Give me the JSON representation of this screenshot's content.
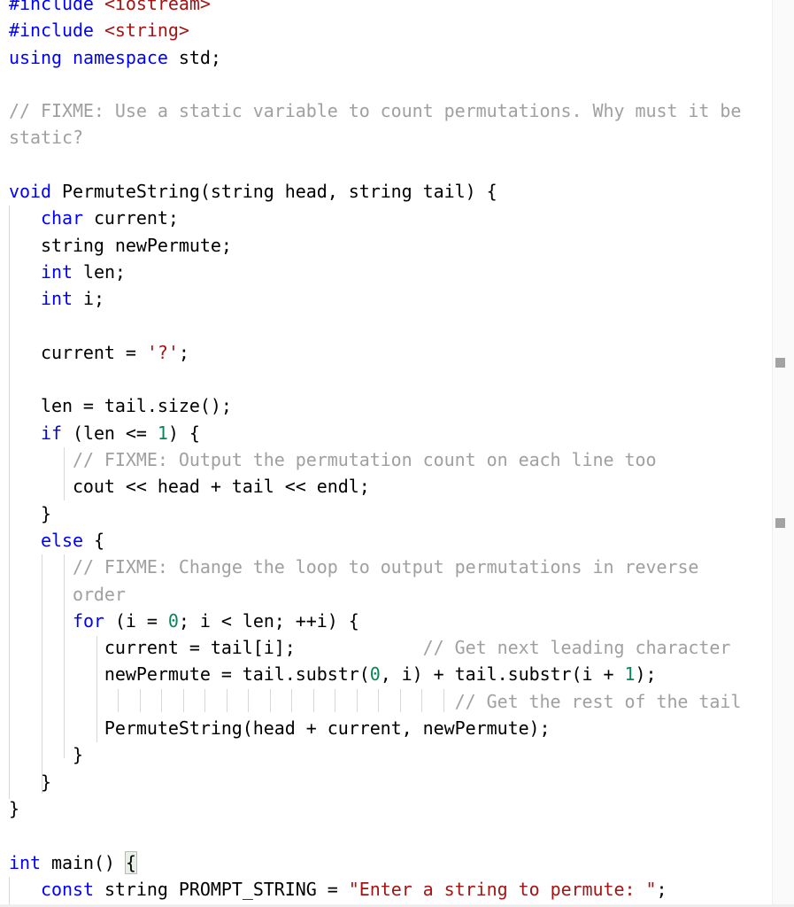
{
  "editor": {
    "language": "cpp",
    "lines": [
      [
        {
          "t": "#include",
          "c": "kw"
        },
        {
          "t": " "
        },
        {
          "t": "<iostream>",
          "c": "str"
        }
      ],
      [
        {
          "t": "#include",
          "c": "kw"
        },
        {
          "t": " "
        },
        {
          "t": "<string>",
          "c": "str"
        }
      ],
      [
        {
          "t": "using",
          "c": "kw"
        },
        {
          "t": " "
        },
        {
          "t": "namespace",
          "c": "kw"
        },
        {
          "t": " std;"
        }
      ],
      [],
      [
        {
          "t": "// FIXME: Use a static variable to count permutations. Why must it be",
          "c": "cm"
        }
      ],
      [
        {
          "t": "static?",
          "c": "cm"
        }
      ],
      [],
      [
        {
          "t": "void",
          "c": "kw"
        },
        {
          "t": " PermuteString(string head, string tail) {"
        }
      ],
      [
        {
          "t": "   "
        },
        {
          "t": "char",
          "c": "kw"
        },
        {
          "t": " current;"
        }
      ],
      [
        {
          "t": "   string newPermute;"
        }
      ],
      [
        {
          "t": "   "
        },
        {
          "t": "int",
          "c": "kw"
        },
        {
          "t": " len;"
        }
      ],
      [
        {
          "t": "   "
        },
        {
          "t": "int",
          "c": "kw"
        },
        {
          "t": " i;"
        }
      ],
      [],
      [
        {
          "t": "   current = "
        },
        {
          "t": "'?'",
          "c": "str"
        },
        {
          "t": ";"
        }
      ],
      [],
      [
        {
          "t": "   len = tail.size();"
        }
      ],
      [
        {
          "t": "   "
        },
        {
          "t": "if",
          "c": "kw"
        },
        {
          "t": " (len <= "
        },
        {
          "t": "1",
          "c": "num"
        },
        {
          "t": ") {"
        }
      ],
      [
        {
          "t": "      "
        },
        {
          "t": "// FIXME: Output the permutation count on each line too",
          "c": "cm"
        }
      ],
      [
        {
          "t": "      cout << head + tail << endl;"
        }
      ],
      [
        {
          "t": "   }"
        }
      ],
      [
        {
          "t": "   "
        },
        {
          "t": "else",
          "c": "kw"
        },
        {
          "t": " {"
        }
      ],
      [
        {
          "t": "      "
        },
        {
          "t": "// FIXME: Change the loop to output permutations in reverse",
          "c": "cm"
        }
      ],
      [
        {
          "t": "      "
        },
        {
          "t": "order",
          "c": "cm"
        }
      ],
      [
        {
          "t": "      "
        },
        {
          "t": "for",
          "c": "kw"
        },
        {
          "t": " (i = "
        },
        {
          "t": "0",
          "c": "num"
        },
        {
          "t": "; i < len; ++i) {"
        }
      ],
      [
        {
          "t": "         current = tail[i];            "
        },
        {
          "t": "// Get next leading character",
          "c": "cm"
        }
      ],
      [
        {
          "t": "         newPermute = tail.substr("
        },
        {
          "t": "0",
          "c": "num"
        },
        {
          "t": ", i) + tail.substr(i + "
        },
        {
          "t": "1",
          "c": "num"
        },
        {
          "t": ");"
        }
      ],
      [
        {
          "t": "                                          "
        },
        {
          "t": "// Get the rest of the tail",
          "c": "cm"
        }
      ],
      [
        {
          "t": "         PermuteString(head + current, newPermute);"
        }
      ],
      [
        {
          "t": "      }"
        }
      ],
      [
        {
          "t": "   }"
        }
      ],
      [
        {
          "t": "}"
        }
      ],
      [],
      [
        {
          "t": "int",
          "c": "kw"
        },
        {
          "t": " main() "
        },
        {
          "t": "{",
          "c": "match"
        }
      ],
      [
        {
          "t": "   "
        },
        {
          "t": "const",
          "c": "kw"
        },
        {
          "t": " string PROMPT_STRING = "
        },
        {
          "t": "\"Enter a string to permute: \"",
          "c": "str"
        },
        {
          "t": ";"
        }
      ]
    ]
  },
  "colors": {
    "keyword": "#0000ff",
    "string": "#a31515",
    "number": "#098658",
    "comment": "#a0a0a0",
    "text": "#000000",
    "indent_guide": "#d8d8d8",
    "overview_marker": "#a3a3a3"
  },
  "overview_ruler": {
    "markers": [
      "line-13",
      "line-19"
    ]
  }
}
